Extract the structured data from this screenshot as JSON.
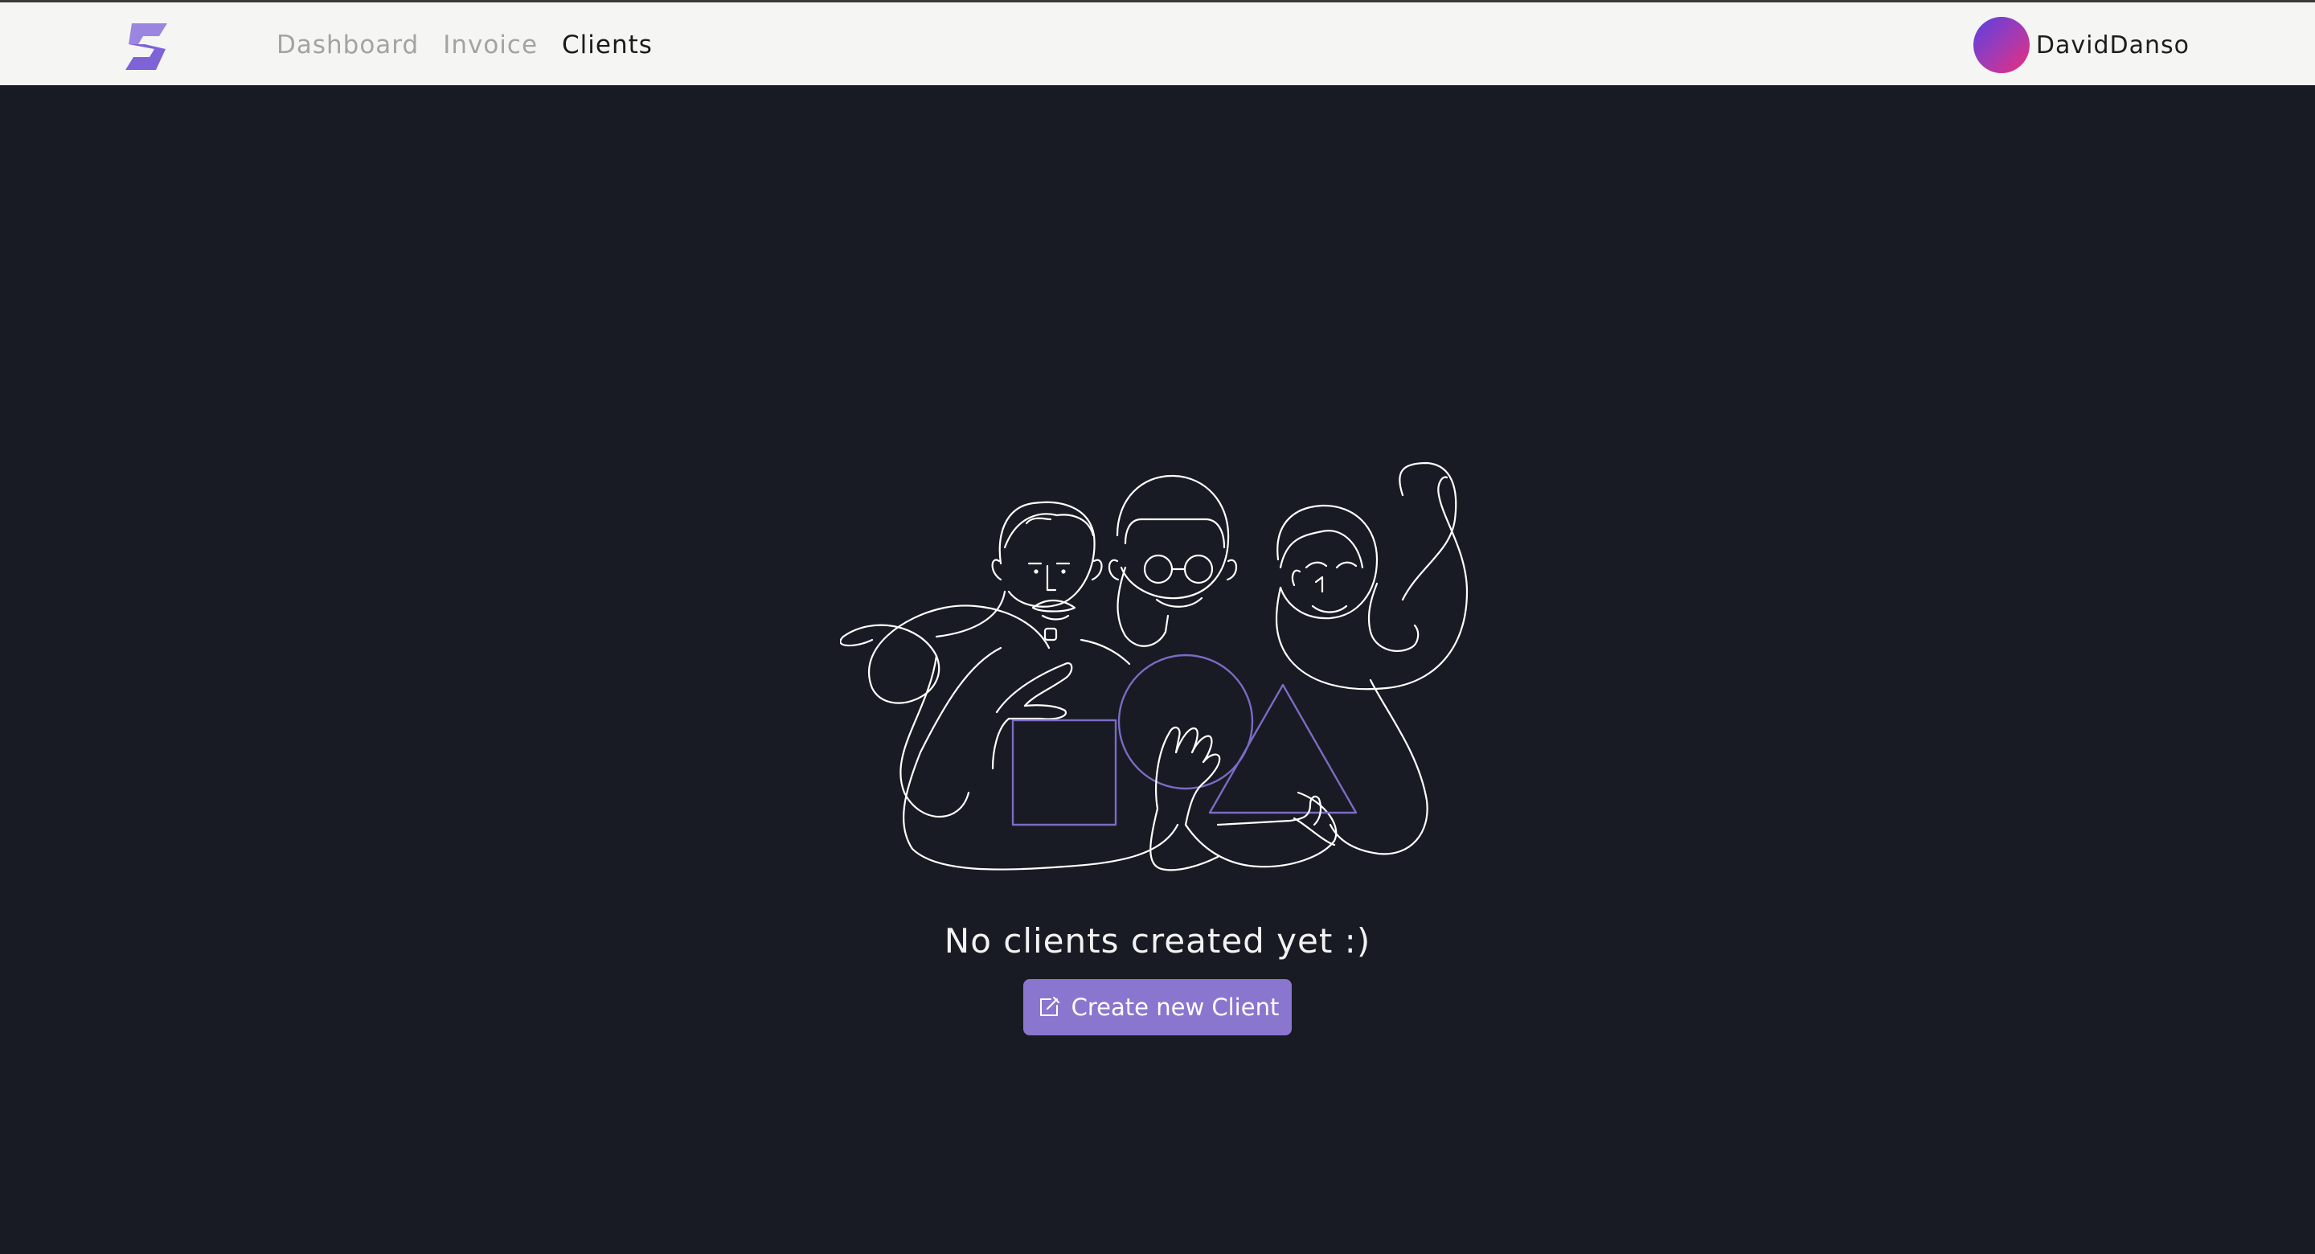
{
  "header": {
    "logo_icon": "brand-s-logo-icon",
    "nav": [
      {
        "label": "Dashboard",
        "active": false
      },
      {
        "label": "Invoice",
        "active": false
      },
      {
        "label": "Clients",
        "active": true
      }
    ],
    "user": {
      "name": "DavidDanso",
      "avatar_icon": "gradient-avatar"
    }
  },
  "empty_state": {
    "illustration_icon": "three-people-line-art-illustration",
    "message": "No clients created yet :)",
    "button": {
      "label": "Create new Client",
      "icon": "edit-icon"
    }
  },
  "colors": {
    "header_bg": "#f5f5f4",
    "page_bg": "#181b23",
    "accent": "#8b76cf",
    "illustration_line": "#ffffff",
    "illustration_accent": "#7b6bc4"
  }
}
